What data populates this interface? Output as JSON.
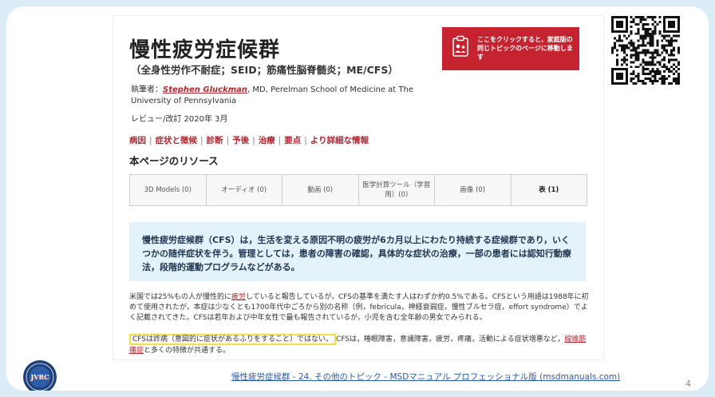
{
  "article": {
    "title": "慢性疲労症候群",
    "subtitle": "（全身性労作不耐症；SEID；筋痛性脳脊髄炎；ME/CFS）",
    "author_prefix": "執筆者：",
    "author_name": "Stephen Gluckman",
    "author_affiliation": ", MD, Perelman School of Medicine at The University of Pennsylvania",
    "review": "レビュー/改訂 2020年 3月"
  },
  "nav_links": [
    "病因",
    "症状と徴候",
    "診断",
    "予後",
    "治療",
    "要点",
    "より詳細な情報"
  ],
  "nav_separator": "|",
  "resources": {
    "heading": "本ページのリソース",
    "tabs": [
      "3D Models (0)",
      "オーディオ (0)",
      "動画 (0)",
      "医学計算ツール（学習用）(0)",
      "画像 (0)",
      "表 (1)"
    ]
  },
  "summary": "慢性疲労症候群（CFS）は，生活を変える原因不明の疲労が6カ月以上にわたり持続する症候群であり，いくつかの随伴症状を伴う。管理としては，患者の障害の確認，具体的な症状の治療，一部の患者には認知行動療法，段階的運動プログラムなどがある。",
  "body1": {
    "before": "米国では25%もの人が慢性的に",
    "link": "疲労",
    "after": "していると報告しているが，CFSの基準を満たす人はわずか約0.5%である。CFSという用語は1988年に初めて使用されたが，本症は少なくとも1700年代中ごろから別の名称（例，febricula，神経衰弱症，慢性ブルセラ症，effort syndrome）でよく記載されてきた。CFSは若年および中年女性で最も報告されているが，小児を含む全年齢の男女でみられる。"
  },
  "body2": {
    "highlight": "CFSは詐病（意図的に症状があるふりをすること）ではない。",
    "before_link": "CFSは，睡眠障害，意識障害，疲労，疼痛，活動による症状増悪など，",
    "link": "線維筋痛症",
    "after": "と多くの特徴が共通する。"
  },
  "banner": {
    "text": "ここをクリックすると，家庭版の同じトピックのページに移動します",
    "icon": "clipboard-family-icon"
  },
  "footer": {
    "link": "慢性疲労症候群 - 24. その他のトピック - MSDマニュアル プロフェッショナル版 (msdmanuals.com)",
    "page_number": "4",
    "logo_text": "JVRC"
  },
  "colors": {
    "accent_red": "#b3242c",
    "banner_red": "#c4232f",
    "summary_bg": "#e4f3fb",
    "page_bg": "#dcecf7",
    "highlight_yellow": "#f2e03c"
  }
}
